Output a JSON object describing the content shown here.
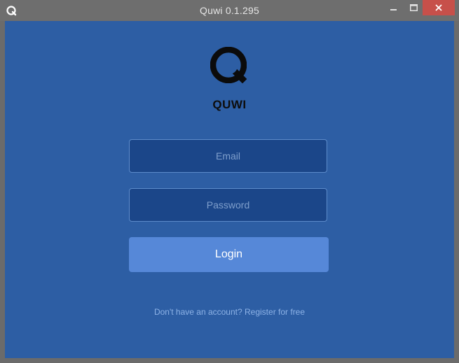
{
  "window": {
    "title": "Quwi 0.1.295",
    "app_icon": "quwi-logo-icon",
    "controls": {
      "minimize": "minimize-icon",
      "maximize": "maximize-icon",
      "close": "close-icon",
      "close_color": "#c7504a"
    }
  },
  "login": {
    "logo_icon": "quwi-logo-icon",
    "brand": "QUWI",
    "email": {
      "placeholder": "Email",
      "value": ""
    },
    "password": {
      "placeholder": "Password",
      "value": ""
    },
    "login_label": "Login",
    "register_prompt": "Don't have an account?",
    "register_link": "Register for free"
  },
  "colors": {
    "background": "#2d5ea4",
    "input_background": "#1b4689",
    "button": "#5688d8",
    "link": "#8db2e6"
  }
}
